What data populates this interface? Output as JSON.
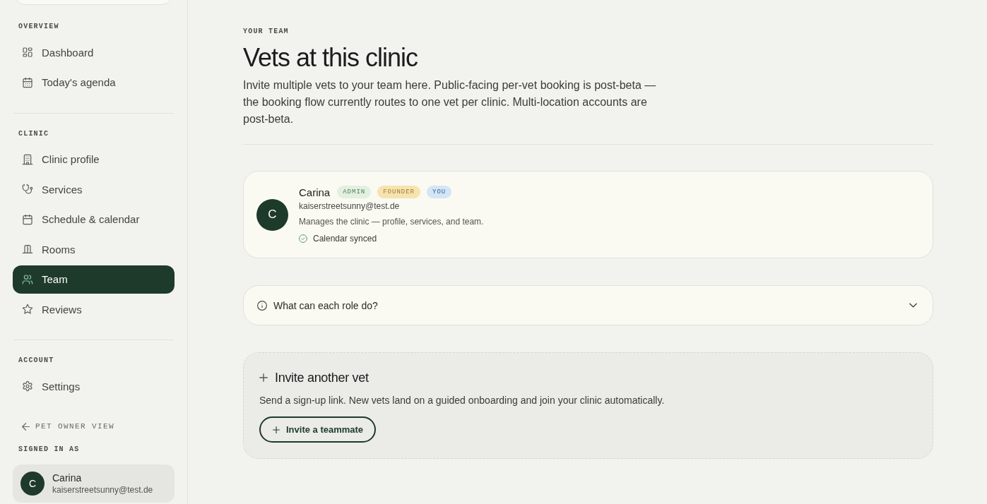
{
  "sidebar": {
    "sections": [
      {
        "heading": "OVERVIEW",
        "items": [
          {
            "label": "Dashboard",
            "selected": false
          },
          {
            "label": "Today's agenda",
            "selected": false
          }
        ]
      },
      {
        "heading": "CLINIC",
        "items": [
          {
            "label": "Clinic profile",
            "selected": false
          },
          {
            "label": "Services",
            "selected": false
          },
          {
            "label": "Schedule & calendar",
            "selected": false
          },
          {
            "label": "Rooms",
            "selected": false
          },
          {
            "label": "Team",
            "selected": true
          },
          {
            "label": "Reviews",
            "selected": false
          }
        ]
      },
      {
        "heading": "ACCOUNT",
        "items": [
          {
            "label": "Settings",
            "selected": false
          }
        ]
      }
    ],
    "back_link": "PET OWNER VIEW",
    "signed_in": {
      "heading": "SIGNED IN AS",
      "initial": "C",
      "name": "Carina",
      "email": "kaiserstreetsunny@test.de"
    }
  },
  "main": {
    "eyebrow": "YOUR TEAM",
    "title": "Vets at this clinic",
    "intro": "Invite multiple vets to your team here. Public-facing per-vet booking is post-beta — the booking flow currently routes to one vet per clinic. Multi-location accounts are post-beta.",
    "members": [
      {
        "initial": "C",
        "name": "Carina",
        "badges": [
          {
            "label": "ADMIN",
            "color": "#e3efe2"
          },
          {
            "label": "FOUNDER",
            "color": "#f7e3b0"
          },
          {
            "label": "YOU",
            "color": "#d5e5f4"
          }
        ],
        "email": "kaiserstreetsunny@test.de",
        "description": "Manages the clinic — profile, services, and team.",
        "calendar": {
          "label": "Calendar synced",
          "synced": true
        }
      }
    ],
    "roles_help": {
      "label": "What can each role do?",
      "expanded": false
    },
    "invite": {
      "title": "Invite another vet",
      "description": "Send a sign-up link. New vets land on a guided onboarding and join your clinic automatically.",
      "button": "Invite a teammate"
    }
  }
}
